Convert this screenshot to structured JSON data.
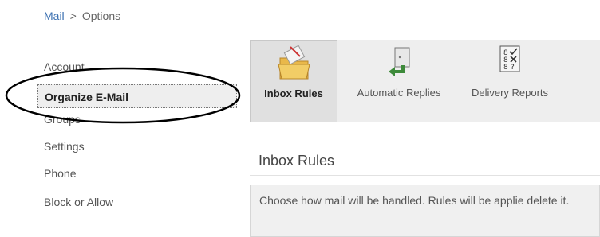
{
  "breadcrumb": {
    "root": "Mail",
    "separator": ">",
    "current": "Options"
  },
  "sidebar": {
    "items": [
      {
        "label": "Account"
      },
      {
        "label": "Organize E-Mail",
        "selected": true
      },
      {
        "label": "Groups"
      },
      {
        "label": "Settings"
      },
      {
        "label": "Phone"
      },
      {
        "label": "Block or Allow"
      }
    ]
  },
  "toolbar": {
    "tools": [
      {
        "label": "Inbox Rules",
        "icon": "folder-icon",
        "active": true
      },
      {
        "label": "Automatic Replies",
        "icon": "reply-arrow-icon"
      },
      {
        "label": "Delivery Reports",
        "icon": "report-checklist-icon"
      }
    ]
  },
  "content": {
    "title": "Inbox Rules",
    "description": "Choose how mail will be handled. Rules will be applie delete it."
  },
  "colors": {
    "link": "#3a6fb0",
    "selected_bg": "#eeeeee",
    "annotation": "#000000"
  }
}
